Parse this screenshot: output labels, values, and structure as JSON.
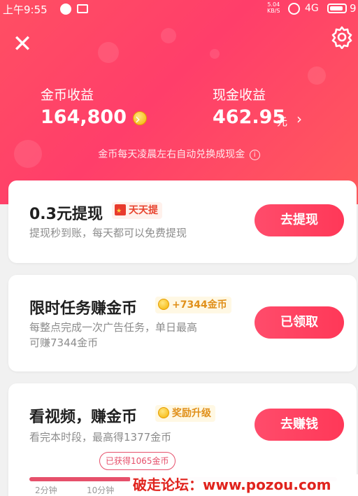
{
  "status_bar": {
    "time": "上午9:55",
    "net_speed_value": "5.04",
    "net_speed_unit": "KB/S",
    "signal": "4G",
    "battery_level": "9"
  },
  "header": {
    "gold": {
      "label": "金币收益",
      "value": "164,800"
    },
    "cash": {
      "label": "现金收益",
      "value": "462.95",
      "unit": "元"
    },
    "notice": "金币每天凌晨左右自动兑换成现金",
    "chevron": "›"
  },
  "cards": [
    {
      "title": "0.3元提现",
      "tag": "天天提",
      "desc": "提现秒到账，每天都可以免费提现",
      "button": "去提现"
    },
    {
      "title": "限时任务赚金币",
      "tag": "+7344金币",
      "desc_line1": "每整点完成一次广告任务，单日最高",
      "desc_line2": "可赚7344金币",
      "button": "已领取"
    },
    {
      "title": "看视频，赚金币",
      "tag": "奖励升级",
      "desc": "看完本时段，最高得1377金币",
      "button": "去赚钱"
    }
  ],
  "video_progress": {
    "earned": "已获得1065金币",
    "fill_fraction": 0.33,
    "ticks": [
      "2分钟",
      "10分钟"
    ]
  },
  "watermark": "破走论坛：www.pozou.com",
  "colors": {
    "accent": "#ff3e6a",
    "button": "#ff4468",
    "tag_red": "#e8442f",
    "tag_gold": "#e0901a"
  }
}
